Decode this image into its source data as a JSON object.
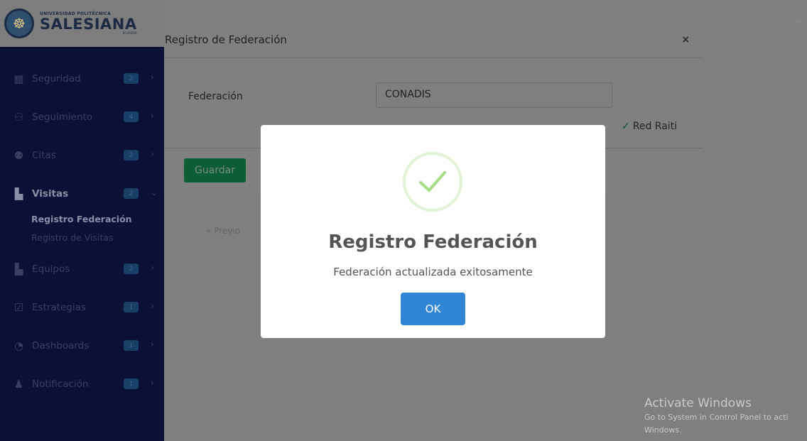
{
  "logo": {
    "small": "UNIVERSIDAD POLITÉCNICA",
    "big": "SALESIANA",
    "tiny": "ECUADOR"
  },
  "sidebar": {
    "items": [
      {
        "label": "Seguridad",
        "badge": "2",
        "icon": "grid-icon"
      },
      {
        "label": "Seguimiento",
        "badge": "4",
        "icon": "binoculars-icon"
      },
      {
        "label": "Citas",
        "badge": "2",
        "icon": "people-icon"
      },
      {
        "label": "Visitas",
        "badge": "2",
        "icon": "map-icon"
      },
      {
        "label": "Equipos",
        "badge": "2",
        "icon": "map-icon"
      },
      {
        "label": "Estrategias",
        "badge": "1",
        "icon": "checklist-icon"
      },
      {
        "label": "Dashboards",
        "badge": "1",
        "icon": "gauge-icon"
      },
      {
        "label": "Notificación",
        "badge": "1",
        "icon": "bell-icon"
      }
    ],
    "submenu": [
      "Registro Federación",
      "Registro de Visitas"
    ]
  },
  "background": {
    "prev_link": "Previo"
  },
  "registro_modal": {
    "title": "Registro de Federación",
    "close": "×",
    "field_label": "Federación",
    "field_value": "CONADIS",
    "valid_text": "Red Raiti",
    "save_label": "Guardar"
  },
  "dialog": {
    "title": "Registro Federación",
    "text": "Federación actualizada exitosamente",
    "ok_label": "OK",
    "colors": {
      "button": "#3085d6",
      "check": "#a5dc86"
    }
  },
  "watermark": {
    "title": "Activate Windows",
    "line1": "Go to System in Control Panel to acti",
    "line2": "Windows."
  }
}
